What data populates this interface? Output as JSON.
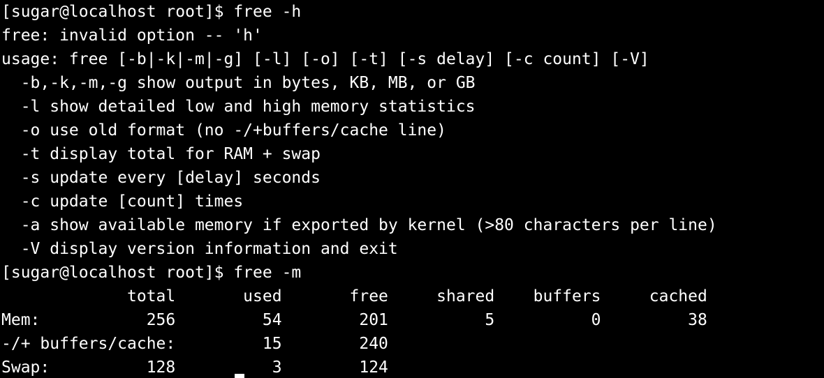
{
  "terminal": {
    "lines": [
      "[sugar@localhost root]$ free -h",
      "free: invalid option -- 'h'",
      "usage: free [-b|-k|-m|-g] [-l] [-o] [-t] [-s delay] [-c count] [-V]",
      "  -b,-k,-m,-g show output in bytes, KB, MB, or GB",
      "  -l show detailed low and high memory statistics",
      "  -o use old format (no -/+buffers/cache line)",
      "  -t display total for RAM + swap",
      "  -s update every [delay] seconds",
      "  -c update [count] times",
      "  -a show available memory if exported by kernel (>80 characters per line)",
      "  -V display version information and exit",
      "[sugar@localhost root]$ free -m",
      "             total       used       free     shared    buffers     cached",
      "Mem:           256         54        201          5          0         38",
      "-/+ buffers/cache:         15        240",
      "Swap:          128          3        124"
    ]
  }
}
